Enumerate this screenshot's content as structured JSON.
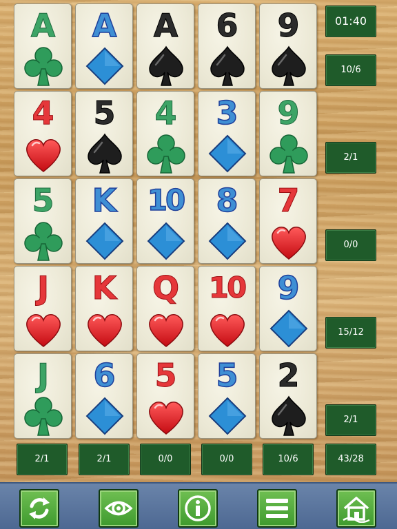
{
  "colors": {
    "red": "#e5373a",
    "black": "#2b2b2b",
    "green": "#3da466",
    "blue": "#3f8fd4",
    "score_bg": "#1f5b2a",
    "toolbar_bg": "#5a759e",
    "tool_bg": "#4fae3b"
  },
  "grid": [
    [
      {
        "rank": "A",
        "suit": "club"
      },
      {
        "rank": "A",
        "suit": "diamond"
      },
      {
        "rank": "A",
        "suit": "spade"
      },
      {
        "rank": "6",
        "suit": "spade"
      },
      {
        "rank": "9",
        "suit": "spade"
      }
    ],
    [
      {
        "rank": "4",
        "suit": "heart"
      },
      {
        "rank": "5",
        "suit": "spade"
      },
      {
        "rank": "4",
        "suit": "club"
      },
      {
        "rank": "3",
        "suit": "diamond"
      },
      {
        "rank": "9",
        "suit": "club"
      }
    ],
    [
      {
        "rank": "5",
        "suit": "club"
      },
      {
        "rank": "K",
        "suit": "diamond"
      },
      {
        "rank": "10",
        "suit": "diamond"
      },
      {
        "rank": "8",
        "suit": "diamond"
      },
      {
        "rank": "7",
        "suit": "heart"
      }
    ],
    [
      {
        "rank": "J",
        "suit": "heart"
      },
      {
        "rank": "K",
        "suit": "heart"
      },
      {
        "rank": "Q",
        "suit": "heart"
      },
      {
        "rank": "10",
        "suit": "heart"
      },
      {
        "rank": "9",
        "suit": "diamond"
      }
    ],
    [
      {
        "rank": "J",
        "suit": "club"
      },
      {
        "rank": "6",
        "suit": "diamond"
      },
      {
        "rank": "5",
        "suit": "heart"
      },
      {
        "rank": "5",
        "suit": "diamond"
      },
      {
        "rank": "2",
        "suit": "spade"
      }
    ]
  ],
  "timer": "01:40",
  "row_scores": [
    "10/6",
    "2/1",
    "0/0",
    "15/12",
    "2/1"
  ],
  "column_scores": [
    "2/1",
    "2/1",
    "0/0",
    "0/0",
    "10/6"
  ],
  "total_score": "43/28",
  "toolbar": [
    {
      "name": "refresh-button",
      "icon": "refresh-icon"
    },
    {
      "name": "view-button",
      "icon": "eye-icon"
    },
    {
      "name": "info-button",
      "icon": "info-icon"
    },
    {
      "name": "menu-button",
      "icon": "menu-icon"
    },
    {
      "name": "home-button",
      "icon": "home-icon"
    }
  ]
}
